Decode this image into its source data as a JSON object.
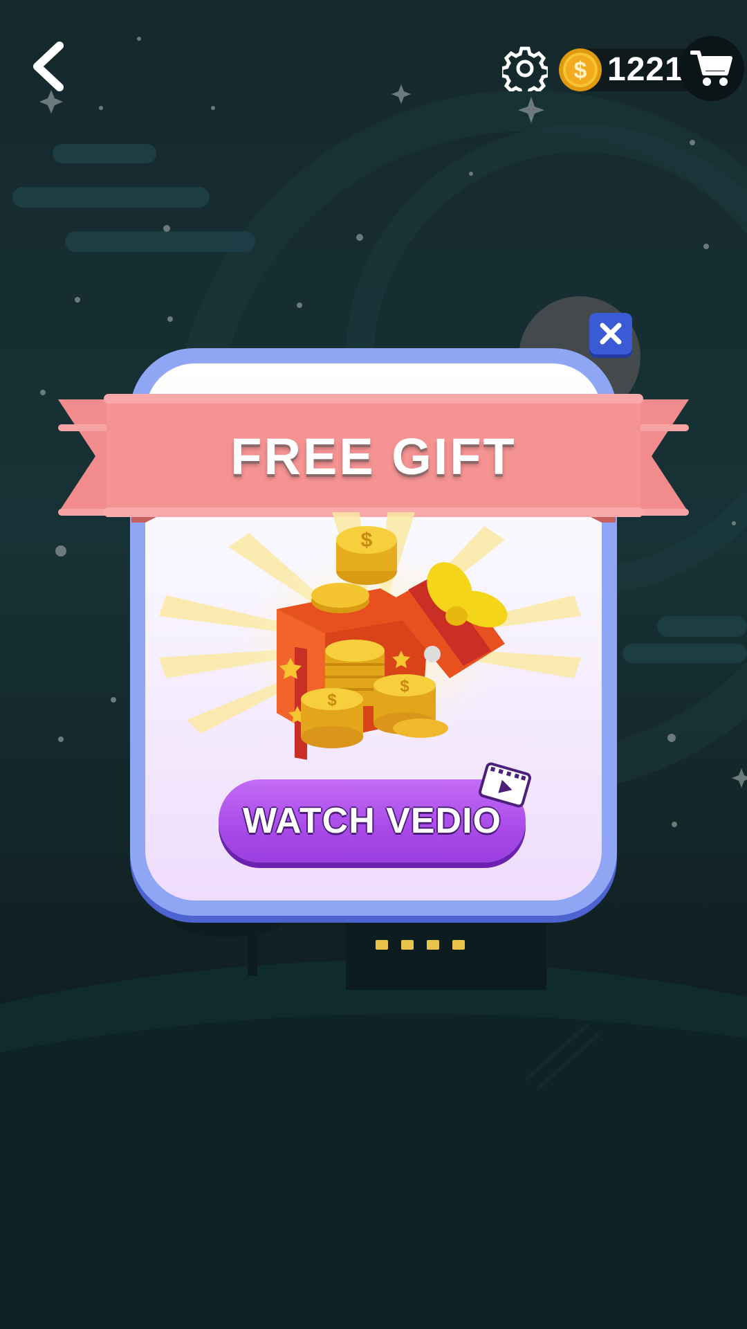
{
  "topbar": {
    "coin_count": "1221",
    "back_icon": "chevron-left-icon",
    "settings_icon": "gear-icon",
    "coin_icon": "dollar-coin-icon",
    "cart_icon": "shopping-cart-icon"
  },
  "dialog": {
    "title": "FREE GIFT",
    "image": "gift-box-with-coins",
    "button_label": "WATCH VEDIO",
    "button_icon": "video-play-icon",
    "close_icon": "close-icon"
  },
  "colors": {
    "background": "#15282c",
    "ribbon": "#f28c8c",
    "dialog_border": "#8ea6f3",
    "button": "#a94ae8",
    "close_button": "#3b5ad6",
    "coin": "#f2b21b"
  }
}
